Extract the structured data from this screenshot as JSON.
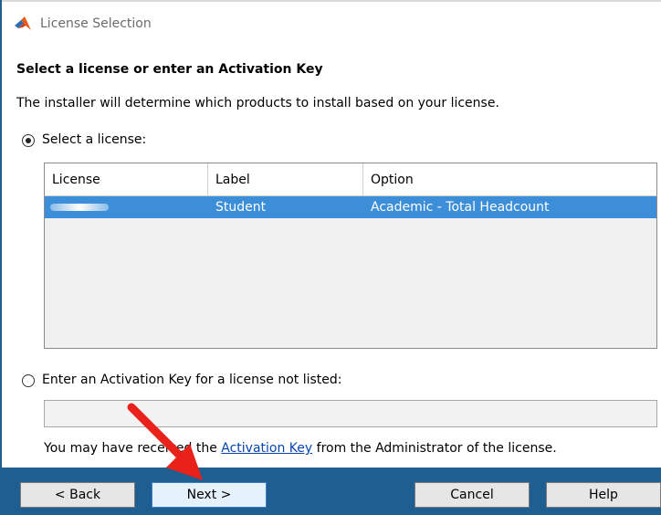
{
  "window": {
    "title": "License Selection"
  },
  "main": {
    "heading": "Select a license or enter an Activation Key",
    "description": "The installer will determine which products to install based on your license.",
    "select_license_label": "Select a license:",
    "activation_option_label": "Enter an Activation Key for a license not listed:",
    "activation_input_value": "",
    "note_prefix": "You may have received the ",
    "note_link": "Activation Key",
    "note_suffix": " from the Administrator of the license."
  },
  "table": {
    "columns": [
      "License",
      "Label",
      "Option"
    ],
    "rows": [
      {
        "license": "",
        "label": "Student",
        "option": "Academic - Total Headcount"
      }
    ]
  },
  "buttons": {
    "back": "< Back",
    "next": "Next >",
    "cancel": "Cancel",
    "help": "Help"
  },
  "colors": {
    "selection": "#3d8ed8",
    "button_bar": "#1f5e91",
    "link": "#0645ad",
    "annotation_arrow": "#e8211b"
  },
  "icons": {
    "app": "matlab-logo-icon",
    "annotation": "red-arrow-icon"
  }
}
